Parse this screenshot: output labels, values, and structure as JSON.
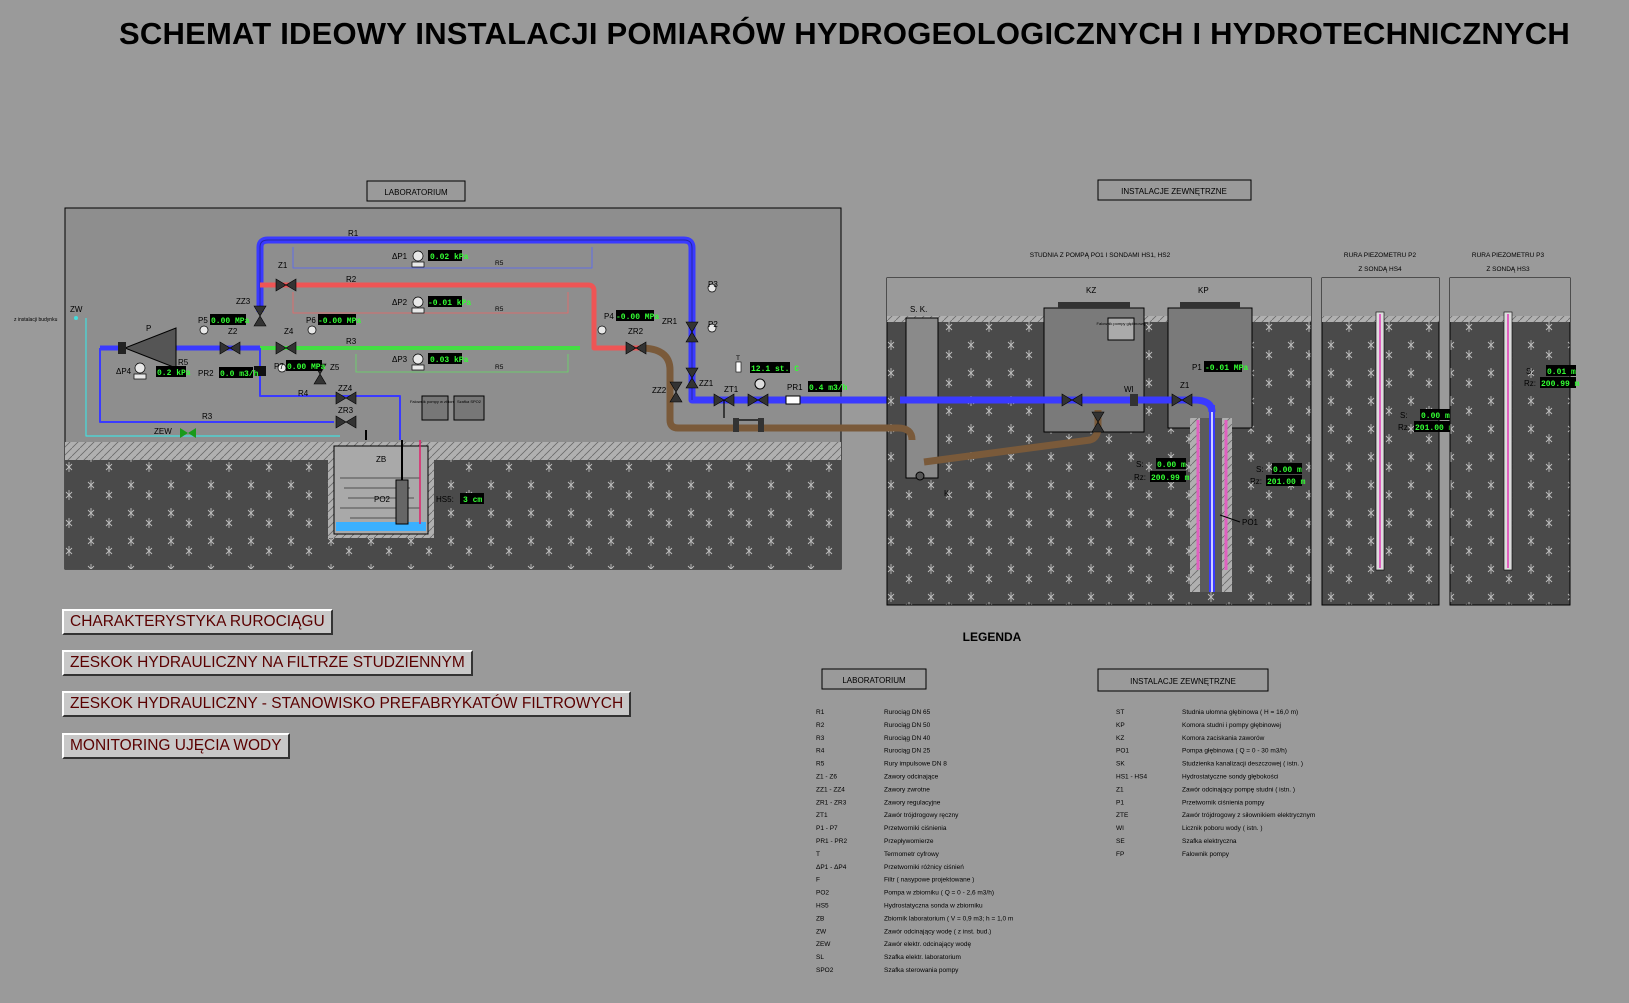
{
  "title": "SCHEMAT IDEOWY INSTALACJI POMIARÓW HYDROGEOLOGICZNYCH I HYDROTECHNICZNYCH",
  "sections": {
    "lab": "LABORATORIUM",
    "ext": "INSTALACJE ZEWNĘTRZNE",
    "well": "STUDNIA Z POMPĄ PO1 I SONDAMI HS1, HS2",
    "p2a": "RURA PIEZOMETRU P2",
    "p2b": "Z SONDĄ HS4",
    "p3a": "RURA PIEZOMETRU P3",
    "p3b": "Z SONDĄ HS3",
    "legend": "LEGENDA",
    "from_bld": "z instalacji budynku"
  },
  "nav": [
    "CHARAKTERYSTYKA RUROCIĄGU",
    "ZESKOK HYDRAULICZNY NA FILTRZE STUDZIENNYM",
    "ZESKOK HYDRAULICZNY - STANOWISKO PREFABRYKATÓW FILTROWYCH",
    "MONITORING UJĘCIA WODY"
  ],
  "labels": {
    "R1": "R1",
    "R2": "R2",
    "R3": "R3",
    "R4": "R4",
    "R5": "R5",
    "P": "P",
    "ZW": "ZW",
    "ZEW": "ZEW",
    "ZB": "ZB",
    "PO2": "PO2",
    "HS5": "HS5:",
    "PR2": "PR2",
    "PR1": "PR1",
    "Z1": "Z1",
    "Z2": "Z2",
    "Z3": "Z3",
    "Z4": "Z4",
    "Z5": "Z5",
    "Z6": "Z6",
    "ZZ1": "ZZ1",
    "ZZ2": "ZZ2",
    "ZZ3": "ZZ3",
    "ZZ4": "ZZ4",
    "ZR1": "ZR1",
    "ZR2": "ZR2",
    "ZR3": "ZR3",
    "ZT1": "ZT1",
    "P1": "P1",
    "P2": "P2",
    "P3": "P3",
    "P4": "P4",
    "P5": "P5",
    "P6": "P6",
    "P7": "P7",
    "dP1": "ΔP1",
    "dP2": "ΔP2",
    "dP3": "ΔP3",
    "dP4": "ΔP4",
    "T": "T",
    "SK": "S. K.",
    "K": "K",
    "KZ": "KZ",
    "KP": "KP",
    "WI": "WI",
    "PO1": "PO1",
    "S": "S:",
    "Rz": "Rz:",
    "box1": "Falownik pompy głębinowej",
    "box2": "Falownik pompy w zbiorniku",
    "box3": "Szafka SPO2"
  },
  "readings": {
    "dP1": "0.02 kPa",
    "dP2": "-0.01 kPa",
    "dP3": "0.03 kPa",
    "dP4": "0.2 kPa",
    "P5": "0.00 MPa",
    "P6": "-0.00 MPa",
    "P4": "-0.00 MPa",
    "P7": "0.00 MPa",
    "P1": "-0.01 MPa",
    "PR2": "0.0 m3/h",
    "PR1": "0.4 m3/h",
    "T": "12.1 st. C",
    "HS5": "3 cm",
    "well1_S": "0.00 m",
    "well1_Rz": "200.99 m",
    "well2_S": "0.00 m",
    "well2_Rz": "201.00 m",
    "p2_S": "0.00 m",
    "p2_Rz": "201.00 m",
    "p3_S": "0.01 m",
    "p3_Rz": "200.99 m"
  },
  "legend_lab": [
    [
      "R1",
      "Rurociąg DN 65"
    ],
    [
      "R2",
      "Rurociąg DN 50"
    ],
    [
      "R3",
      "Rurociąg DN 40"
    ],
    [
      "R4",
      "Rurociąg DN 25"
    ],
    [
      "R5",
      "Rury impulsowe DN 8"
    ],
    [
      "Z1 - Z6",
      "Zawory odcinające"
    ],
    [
      "ZZ1 - ZZ4",
      "Zawory zwrotne"
    ],
    [
      "ZR1 - ZR3",
      "Zawory regulacyjne"
    ],
    [
      "ZT1",
      "Zawór trójdrogowy ręczny"
    ],
    [
      "P1 - P7",
      "Przetworniki ciśnienia"
    ],
    [
      "PR1 - PR2",
      "Przepływomierze"
    ],
    [
      "T",
      "Termometr cyfrowy"
    ],
    [
      "ΔP1 - ΔP4",
      "Przetworniki różnicy ciśnień"
    ],
    [
      "F",
      "Filtr ( nasypowe projektowane )"
    ],
    [
      "PO2",
      "Pompa w zbiorniku ( Q = 0 - 2,6 m3/h)"
    ],
    [
      "HS5",
      "Hydrostatyczna sonda w zbiorniku"
    ],
    [
      "ZB",
      "Zbiornik laboratorium ( V = 0,9 m3; h = 1,0 m"
    ],
    [
      "ZW",
      "Zawór odcinający wodę ( z inst. bud.)"
    ],
    [
      "ZEW",
      "Zawór elektr. odcinający wodę"
    ],
    [
      "SL",
      "Szafka elektr. laboratorium"
    ],
    [
      "SPO2",
      "Szafka sterowania pompy"
    ]
  ],
  "legend_ext": [
    [
      "ST",
      "Studnia ułomna głębinowa ( H = 16,0 m)"
    ],
    [
      "KP",
      "Komora studni i pompy głębinowej"
    ],
    [
      "KZ",
      "Komora zaciskania zaworów"
    ],
    [
      "PO1",
      "Pompa głębinowa ( Q = 0 - 30 m3/h)"
    ],
    [
      "SK",
      "Studzienka kanalizacji deszczowej ( istn. )"
    ],
    [
      "HS1 - HS4",
      "Hydrostatyczne sondy głębokości"
    ],
    [
      "Z1",
      "Zawór odcinający pompę studni ( istn. )"
    ],
    [
      "P1",
      "Przetwornik ciśnienia pompy"
    ],
    [
      "ZTE",
      "Zawór trójdrogowy z siłownikiem elektrycznym"
    ],
    [
      "WI",
      "Licznik poboru wody ( istn. )"
    ],
    [
      "SE",
      "Szafka elektryczna"
    ],
    [
      "FP",
      "Falownik pompy"
    ]
  ]
}
